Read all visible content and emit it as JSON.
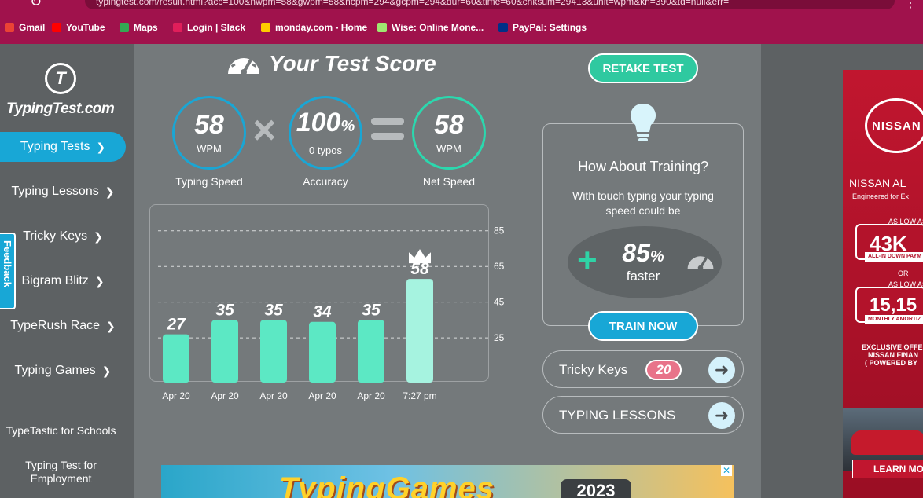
{
  "browser": {
    "url": "typingtest.com/result.html?acc=100&nwpm=58&gwpm=58&ncpm=294&gcpm=294&dur=60&time=60&chksum=29413&unit=wpm&kh=390&td=null&err=",
    "bookmarks": [
      {
        "label": "Gmail",
        "icon": "gmail-icon",
        "color": "#ea4335"
      },
      {
        "label": "YouTube",
        "icon": "youtube-icon",
        "color": "#ff0000"
      },
      {
        "label": "Maps",
        "icon": "maps-icon",
        "color": "#34a853"
      },
      {
        "label": "Login | Slack",
        "icon": "slack-icon",
        "color": "#e01e5a"
      },
      {
        "label": "monday.com - Home",
        "icon": "monday-icon",
        "color": "#ffcb00"
      },
      {
        "label": "Wise: Online Mone...",
        "icon": "wise-icon",
        "color": "#9fe870"
      },
      {
        "label": "PayPal: Settings",
        "icon": "paypal-icon",
        "color": "#003087"
      }
    ]
  },
  "sidebar": {
    "logo_text": "TypingTest.com",
    "items": [
      {
        "label": "Typing Tests",
        "active": true
      },
      {
        "label": "Typing Lessons"
      },
      {
        "label": "Tricky Keys"
      },
      {
        "label": "Bigram Blitz"
      },
      {
        "label": "TypeRush Race"
      },
      {
        "label": "Typing Games"
      }
    ],
    "small_links": [
      "TypeTastic for Schools",
      "Typing Test for Employment"
    ],
    "feedback": "Feedback"
  },
  "score": {
    "title": "Your Test Score",
    "speed": {
      "value": "58",
      "unit": "WPM",
      "label": "Typing Speed"
    },
    "accuracy": {
      "value": "100",
      "unit_sup": "%",
      "sub": "0 typos",
      "label": "Accuracy"
    },
    "net": {
      "value": "58",
      "unit": "WPM",
      "label": "Net Speed"
    }
  },
  "chart_data": {
    "type": "bar",
    "categories": [
      "Apr 20",
      "Apr 20",
      "Apr 20",
      "Apr 20",
      "Apr 20",
      "7:27 pm"
    ],
    "values": [
      27,
      35,
      35,
      34,
      35,
      58
    ],
    "y_ticks": [
      25,
      45,
      65,
      85
    ],
    "ylim": [
      0,
      95
    ],
    "highlight_last": true,
    "colors": {
      "bar": "#5ce8c4",
      "last": "#a6f3e0",
      "grid": "#d8dadb"
    }
  },
  "actions": {
    "retake": "RETAKE TEST",
    "train_now": "TRAIN NOW"
  },
  "training": {
    "heading": "How About Training?",
    "text": "With touch typing your typing speed could be",
    "percent": "85",
    "percent_sign": "%",
    "faster": "faster"
  },
  "links": {
    "tricky_keys": {
      "label": "Tricky Keys",
      "badge": "20"
    },
    "lessons": {
      "label": "TYPING LESSONS"
    }
  },
  "ads": {
    "bottom_word": "TypingGames",
    "bottom_year": "2023",
    "right": {
      "brand": "NISSAN",
      "headline": "NISSAN AL",
      "sub": "Engineered for Ex",
      "as_low_as": "AS LOW AS",
      "price1": "43K",
      "strip1": "ALL-IN DOWN PAYM",
      "or": "OR",
      "price2": "15,15",
      "strip2": "MONTHLY AMORTIZ",
      "offer": "EXCLUSIVE OFFER T",
      "offer2": "NISSAN FINAN",
      "offer3": "( POWERED BY",
      "learn": "LEARN MO"
    }
  }
}
